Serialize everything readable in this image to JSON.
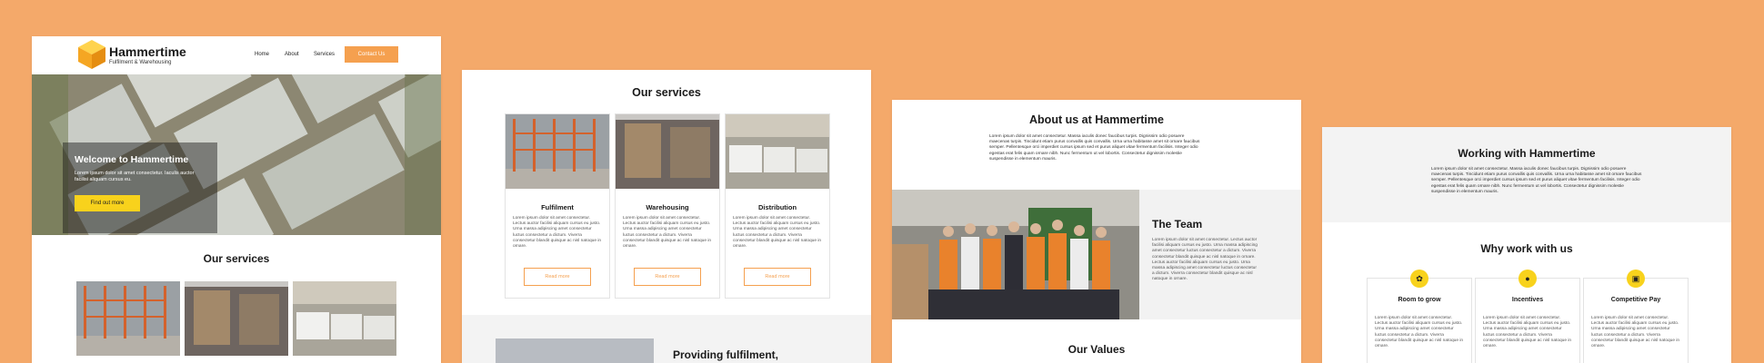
{
  "site": {
    "brand": "Hammertime",
    "tagline": "Fulfilment & Warehousing",
    "nav": [
      "Home",
      "About",
      "Services"
    ],
    "contact_button": "Contact Us",
    "colors": {
      "background": "#F4A96A",
      "accent_orange": "#F5A04F",
      "accent_yellow": "#F8D21C"
    }
  },
  "home": {
    "hero_title": "Welcome to Hammertime",
    "hero_text": "Lorem ipsum dolor sit amet consectetur. Iaculis auctor facilisi aliquam cursus eu.",
    "hero_button": "Find out more",
    "services_title": "Our services"
  },
  "services": {
    "title": "Our services",
    "cards": [
      {
        "title": "Fulfilment",
        "text": "Lorem ipsum dolor sit amet consectetur. Lectus auctor facilisi aliquam cursus eu justo. Urna massa adipiscing amet consectetur luctus consectetur a dictum. Viverra consectetur blandit quisque ac nisl natoque in ornare.",
        "button": "Read more"
      },
      {
        "title": "Warehousing",
        "text": "Lorem ipsum dolor sit amet consectetur. Lectus auctor facilisi aliquam cursus eu justo. Urna massa adipiscing amet consectetur luctus consectetur a dictum. Viverra consectetur blandit quisque ac nisl natoque in ornare.",
        "button": "Read more"
      },
      {
        "title": "Distribution",
        "text": "Lorem ipsum dolor sit amet consectetur. Lectus auctor facilisi aliquam cursus eu justo. Urna massa adipiscing amet consectetur luctus consectetur a dictum. Viverra consectetur blandit quisque ac nisl natoque in ornare.",
        "button": "Read more"
      }
    ],
    "band_title": "Providing fulfilment,"
  },
  "about": {
    "title": "About us at Hammertime",
    "paragraph": "Lorem ipsum dolor sit amet consectetur. Massa iaculis donec faucibus turpis. Dignissim odio posuere maecenas turpis. Tincidunt etiam purus convallis quis convallis. Urna urna habitasse amet sit ornare faucibus semper. Pellentesque orci imperdiet cursus ipsum sed et purus aliquet vitae fermentum facilisis. Integer odio egestas erat felis quam ornare nibh. Nunc fermentum ut vel lobortis. Consectetur dignissim molestie suspendisse in elementum mauris.",
    "team_title": "The Team",
    "team_text": "Lorem ipsum dolor sit amet consectetur. Lectus auctor facilisi aliquam cursus eu justo. Urna massa adipiscing amet consectetur luctus consectetur a dictum. Viverra consectetur blandit quisque ac nisl natoque in ornare. Lectus auctor facilisi aliquam cursus eu justo. Urna massa adipiscing amet consectetur luctus consectetur a dictum. Viverra consectetur blandit quisque ac nisl natoque in ornare.",
    "values_title": "Our Values"
  },
  "working": {
    "title": "Working with Hammertime",
    "paragraph": "Lorem ipsum dolor sit amet consectetur. Massa iaculis donec faucibus turpis. Dignissim odio posuere maecenas turpis. Tincidunt etiam purus convallis quis convallis. Urna urna habitasse amet sit ornare faucibus semper. Pellentesque orci imperdiet cursus ipsum sed et purus aliquet vitae fermentum facilisis. Integer odio egestas erat felis quam ornare nibh. Nunc fermentum ut vel lobortis. Consectetur dignissim molestie suspendisse in elementum mauris.",
    "why_title": "Why work with us",
    "benefits": [
      {
        "icon": "plant-icon",
        "title": "Room to grow",
        "text": "Lorem ipsum dolor sit amet consectetur. Lectus auctor facilisi aliquam cursus eu justo. Urna massa adipiscing amet consectetur luctus consectetur a dictum. Viverra consectetur blandit quisque ac nisl natoque in ornare."
      },
      {
        "icon": "piggy-bank-icon",
        "title": "Incentives",
        "text": "Lorem ipsum dolor sit amet consectetur. Lectus auctor facilisi aliquam cursus eu justo. Urna massa adipiscing amet consectetur luctus consectetur a dictum. Viverra consectetur blandit quisque ac nisl natoque in ornare."
      },
      {
        "icon": "money-icon",
        "title": "Competitive Pay",
        "text": "Lorem ipsum dolor sit amet consectetur. Lectus auctor facilisi aliquam cursus eu justo. Urna massa adipiscing amet consectetur luctus consectetur a dictum. Viverra consectetur blandit quisque ac nisl natoque in ornare."
      }
    ]
  }
}
